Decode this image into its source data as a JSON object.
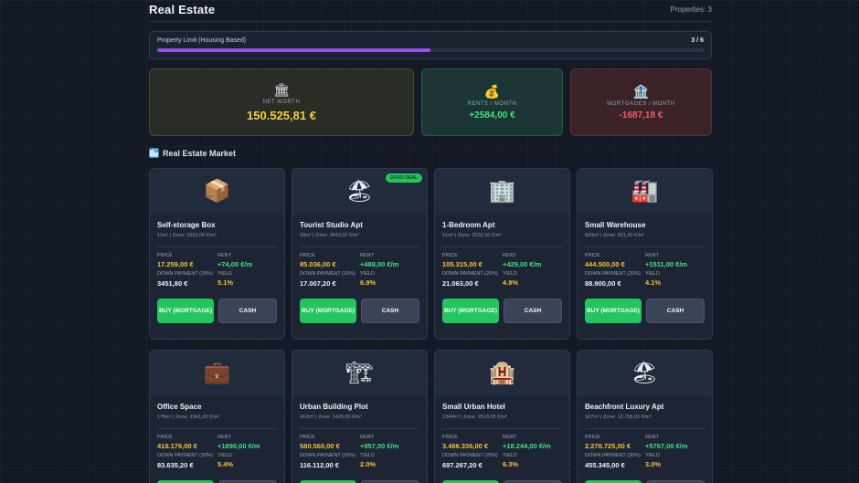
{
  "header": {
    "title": "Real Estate",
    "properties_label": "Properties: 3"
  },
  "limit": {
    "label": "Property Limit (Housing Based)",
    "value": "3 / 6",
    "fill_fraction": 0.5
  },
  "stats": {
    "net_worth": {
      "icon": "🏛",
      "label": "NET WORTH",
      "value": "150.525,81 €"
    },
    "rents": {
      "icon": "💰",
      "label": "RENTS / MONTH",
      "value": "+2584,00 €"
    },
    "mortgages": {
      "icon": "🏦",
      "label": "MORTGAGES / MONTH",
      "value": "-1687,18 €"
    }
  },
  "market": {
    "icon": "🏙",
    "title": "Real Estate Market"
  },
  "labels": {
    "price": "PRICE",
    "rent": "RENT",
    "down": "DOWN PAYMENT (20%)",
    "yield": "YIELD",
    "buy": "BUY (MORTGAGE)",
    "cash": "CASH"
  },
  "cards": [
    {
      "emoji": "📦",
      "name": "Self-storage Box",
      "sub": "11m² | Zone: 1593,00 €/m²",
      "price": "17.259,00 €",
      "rent": "+74,00 €/m",
      "down": "3451,80 €",
      "yield": "5.1%",
      "badge": ""
    },
    {
      "emoji": "🏖",
      "name": "Tourist Studio Apt",
      "sub": "28m² | Zone: 3443,00 €/m²",
      "price": "85.036,00 €",
      "rent": "+488,00 €/m",
      "down": "17.007,20 €",
      "yield": "6.9%",
      "badge": "GOOD DEAL"
    },
    {
      "emoji": "🏢",
      "name": "1-Bedroom Apt",
      "sub": "51m² | Zone: 2032,00 €/m²",
      "price": "105.315,00 €",
      "rent": "+429,00 €/m",
      "down": "21.063,00 €",
      "yield": "4.9%",
      "badge": ""
    },
    {
      "emoji": "🏭",
      "name": "Small Warehouse",
      "sub": "500m² | Zone: 891,00 €/m²",
      "price": "444.500,00 €",
      "rent": "+1511,00 €/m",
      "down": "88.900,00 €",
      "yield": "4.1%",
      "badge": ""
    },
    {
      "emoji": "💼",
      "name": "Office Space",
      "sub": "176m² | Zone: 2341,00 €/m²",
      "price": "418.176,00 €",
      "rent": "+1890,00 €/m",
      "down": "83.635,20 €",
      "yield": "5.4%",
      "badge": ""
    },
    {
      "emoji": "🏗",
      "name": "Urban Building Plot",
      "sub": "410m² | Zone: 1420,00 €/m²",
      "price": "580.560,00 €",
      "rent": "+957,00 €/m",
      "down": "116.112,00 €",
      "yield": "2.0%",
      "badge": ""
    },
    {
      "emoji": "🏨",
      "name": "Small Urban Hotel",
      "sub": "1344m² | Zone: 2613,00 €/m²",
      "price": "3.486.336,00 €",
      "rent": "+18.244,00 €/m",
      "down": "697.267,20 €",
      "yield": "6.3%",
      "badge": ""
    },
    {
      "emoji": "🏖",
      "name": "Beachfront Luxury Apt",
      "sub": "187m² | Zone: 12.158,00 €/m²",
      "price": "2.276.725,00 €",
      "rent": "+5767,00 €/m",
      "down": "455.345,00 €",
      "yield": "3.0%",
      "badge": ""
    }
  ]
}
